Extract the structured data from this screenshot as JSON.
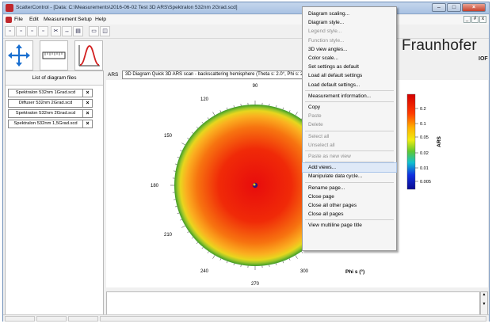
{
  "window": {
    "title": "ScatterControl - [Data: C:\\Measurements\\2016-06-02 Test 3D ARS\\Spektralon 532nm 2Grad.scd]"
  },
  "menubar": {
    "items": [
      "File",
      "Edit",
      "Measurement",
      "Setup",
      "Help"
    ]
  },
  "logo": {
    "name": "Fraunhofer",
    "sub": "IOF"
  },
  "left_panel": {
    "title": "List of diagram files",
    "files": [
      "Spektralon 532nm 1Grad.scd",
      "Diffuser 532nm 2Grad.scd",
      "Spektralon 532nm 2Grad.scd",
      "Spektralon 532nm 1,5Grad.scd"
    ],
    "close_glyph": "×"
  },
  "diagram": {
    "tab_label": "ARS",
    "title": "3D Diagram Quick 3D ARS scan - backscattering hemisphere (Theta s: 2.0°, Phi s: 2.0°)",
    "angle_labels": [
      "90",
      "120",
      "150",
      "180",
      "210",
      "240",
      "270",
      "300"
    ],
    "phi_axis_label": "Phi s (°)",
    "colorbar_label": "ARS",
    "colorbar_ticks": [
      "0.2",
      "0.1",
      "0.05",
      "0.02",
      "0.01",
      "0.005"
    ]
  },
  "context_menu": {
    "items": [
      {
        "label": "Diagram scaling...",
        "enabled": true
      },
      {
        "label": "Diagram style...",
        "enabled": true
      },
      {
        "label": "Legend style...",
        "enabled": false
      },
      {
        "label": "Function style...",
        "enabled": false
      },
      {
        "label": "3D view angles...",
        "enabled": true
      },
      {
        "label": "Color scale...",
        "enabled": true
      },
      {
        "label": "Set settings as default",
        "enabled": true
      },
      {
        "label": "Load all default settings",
        "enabled": true
      },
      {
        "label": "Load default settings...",
        "enabled": true
      },
      {
        "separator": true
      },
      {
        "label": "Measurement information...",
        "enabled": true
      },
      {
        "separator": true
      },
      {
        "label": "Copy",
        "enabled": true
      },
      {
        "label": "Paste",
        "enabled": false
      },
      {
        "label": "Delete",
        "enabled": false
      },
      {
        "separator": true
      },
      {
        "label": "Select all",
        "enabled": false
      },
      {
        "label": "Unselect all",
        "enabled": false
      },
      {
        "separator": true
      },
      {
        "label": "Paste as new view",
        "enabled": false
      },
      {
        "separator": true
      },
      {
        "label": "Add views...",
        "enabled": true,
        "highlighted": true
      },
      {
        "label": "Manipulate data cycle...",
        "enabled": true
      },
      {
        "separator": true
      },
      {
        "label": "Rename page...",
        "enabled": true
      },
      {
        "label": "Close page",
        "enabled": true
      },
      {
        "label": "Close all other pages",
        "enabled": true
      },
      {
        "label": "Close all pages",
        "enabled": true
      },
      {
        "separator": true
      },
      {
        "label": "View multiline page title",
        "enabled": true
      }
    ]
  },
  "colors": {
    "highlight": "#dfe9f7",
    "logo_red": "#c0282d",
    "ring_green": "#5aa228"
  }
}
